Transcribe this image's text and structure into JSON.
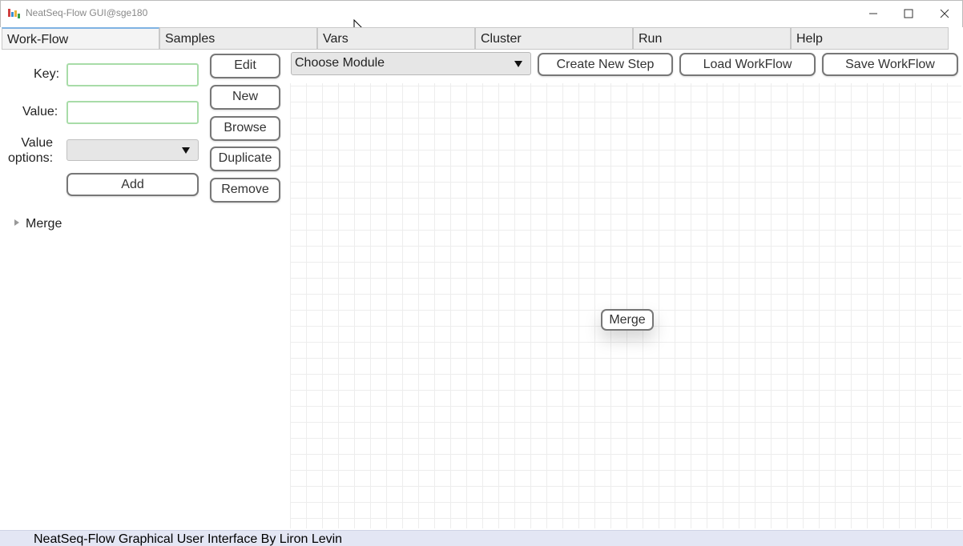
{
  "window": {
    "title": "NeatSeq-Flow GUI@sge180",
    "minimize": "minimize-icon",
    "maximize": "maximize-icon",
    "close": "close-icon"
  },
  "tabs": [
    {
      "label": "Work-Flow",
      "active": true
    },
    {
      "label": "Samples",
      "active": false
    },
    {
      "label": "Vars",
      "active": false
    },
    {
      "label": "Cluster",
      "active": false
    },
    {
      "label": "Run",
      "active": false
    },
    {
      "label": "Help",
      "active": false
    }
  ],
  "form": {
    "key_label": "Key:",
    "key_value": "",
    "value_label": "Value:",
    "value_value": "",
    "options_label_line1": "Value",
    "options_label_line2": "options:",
    "options_selected": "",
    "add_button": "Add"
  },
  "side_buttons": {
    "edit": "Edit",
    "new": "New",
    "browse": "Browse",
    "duplicate": "Duplicate",
    "remove": "Remove"
  },
  "tree": {
    "items": [
      {
        "label": "Merge",
        "expanded": false
      }
    ]
  },
  "toolbar": {
    "module_select": "Choose Module",
    "create_step": "Create New Step",
    "load_workflow": "Load WorkFlow",
    "save_workflow": "Save WorkFlow"
  },
  "canvas": {
    "nodes": [
      {
        "label": "Merge"
      }
    ]
  },
  "status": {
    "text": "NeatSeq-Flow Graphical User Interface By Liron Levin"
  },
  "colors": {
    "field_border": "#a8dca8",
    "active_tab_accent": "#7fb3e3",
    "status_bg": "#e3e6f4"
  }
}
